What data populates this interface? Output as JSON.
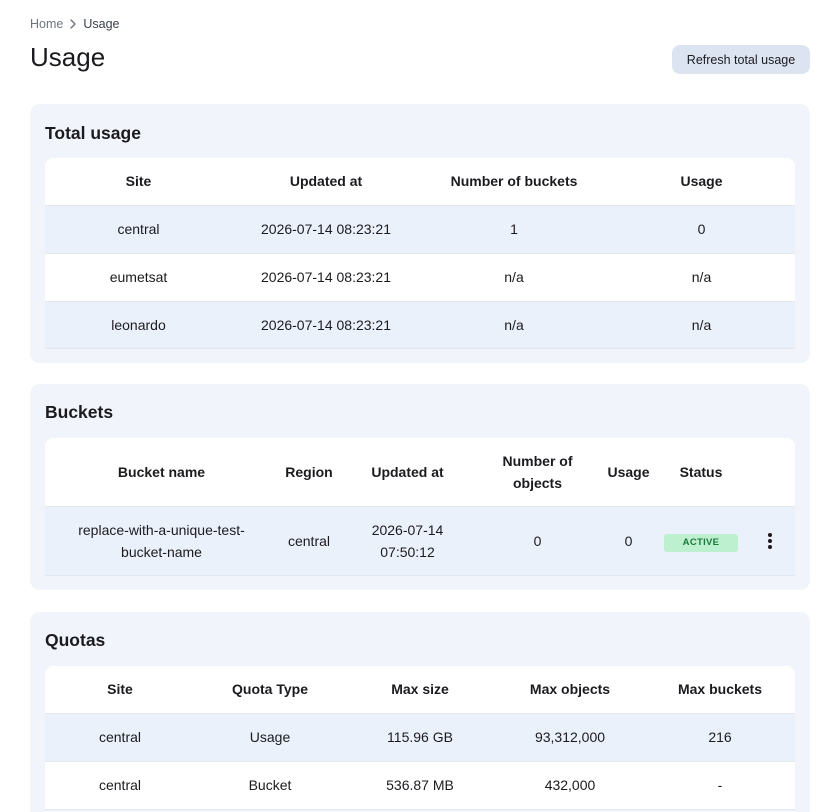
{
  "breadcrumb": {
    "home": "Home",
    "current": "Usage"
  },
  "page": {
    "title": "Usage",
    "refresh_label": "Refresh total usage"
  },
  "total_usage": {
    "title": "Total usage",
    "headers": [
      "Site",
      "Updated at",
      "Number of buckets",
      "Usage"
    ],
    "rows": [
      [
        "central",
        "2026-07-14 08:23:21",
        "1",
        "0"
      ],
      [
        "eumetsat",
        "2026-07-14 08:23:21",
        "n/a",
        "n/a"
      ],
      [
        "leonardo",
        "2026-07-14 08:23:21",
        "n/a",
        "n/a"
      ]
    ]
  },
  "buckets": {
    "title": "Buckets",
    "headers": [
      "Bucket name",
      "Region",
      "Updated at",
      "Number of objects",
      "Usage",
      "Status"
    ],
    "rows": [
      {
        "name": "replace-with-a-unique-test-bucket-name",
        "region": "central",
        "updated_at": "2026-07-14 07:50:12",
        "objects": "0",
        "usage": "0",
        "status": "ACTIVE"
      }
    ]
  },
  "quotas": {
    "title": "Quotas",
    "headers": [
      "Site",
      "Quota Type",
      "Max size",
      "Max objects",
      "Max buckets"
    ],
    "rows": [
      [
        "central",
        "Usage",
        "115.96 GB",
        "93,312,000",
        "216"
      ],
      [
        "central",
        "Bucket",
        "536.87 MB",
        "432,000",
        "-"
      ]
    ]
  },
  "colors": {
    "card_bg": "#f1f5fb",
    "row_alt": "#ebf1fa",
    "button_bg": "#dce4f1",
    "active_badge_bg": "#bdf0cf",
    "active_badge_text": "#1a7a3c"
  },
  "icons": {
    "breadcrumb_separator": "chevron-right-icon",
    "row_actions": "more-vertical-icon"
  }
}
